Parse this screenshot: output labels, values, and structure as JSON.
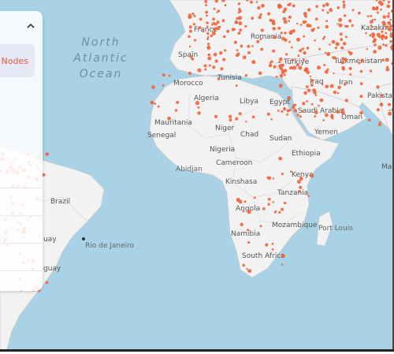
{
  "map": {
    "oceans": [
      {
        "name": "north-atlantic-ocean",
        "lines": [
          "North",
          "Atlantic",
          "Ocean"
        ]
      }
    ],
    "countries": [
      "France",
      "Spain",
      "Morocco",
      "Algeria",
      "Tunisia",
      "Libya",
      "Egypt",
      "Mauritania",
      "Niger",
      "Chad",
      "Sudan",
      "Senegal",
      "Nigeria",
      "Ethiopia",
      "Cameroon",
      "Kenya",
      "Kinshasa",
      "Tanzania",
      "Angola",
      "Namibia",
      "Mozambique",
      "South Africa",
      "Brazil",
      "Romania",
      "Türkiye",
      "Iraq",
      "Iran",
      "Turkmenistan",
      "Saudi Arabia",
      "Yemen",
      "Oman",
      "Kazakhsta",
      "Pakistan",
      "Abidjan",
      "Port Louis",
      "Rio de Janeiro",
      "uay",
      "guay",
      "Mal"
    ],
    "node_color": "#f0643a",
    "land_color": "#f2f2f2",
    "water_color": "#a9d2e6"
  },
  "panel": {
    "chip_label": "e Nodes",
    "partial_text": "es",
    "chevron_icon": "chevron-up-icon"
  }
}
